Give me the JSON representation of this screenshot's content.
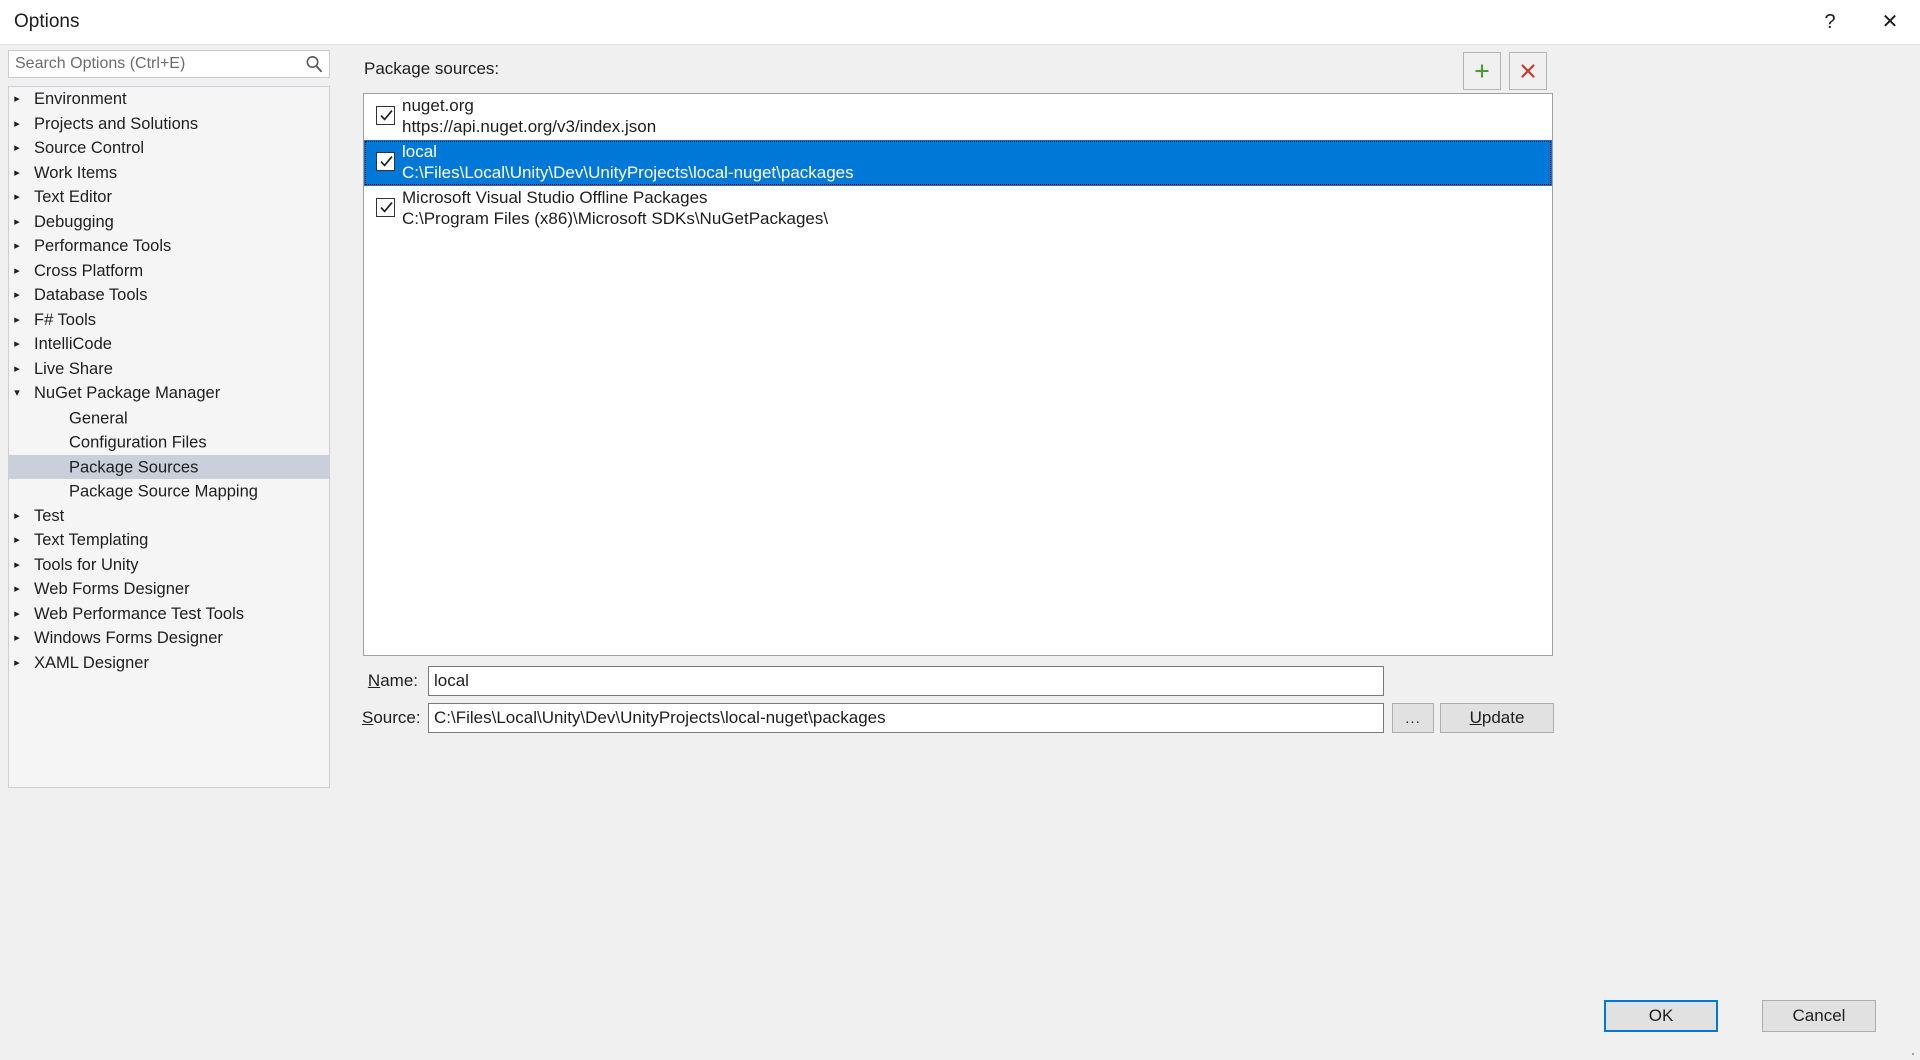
{
  "window": {
    "title": "Options",
    "help_glyph": "?",
    "close_glyph": "✕"
  },
  "search": {
    "placeholder": "Search Options (Ctrl+E)",
    "value": ""
  },
  "tree": {
    "items": [
      {
        "label": "Environment",
        "level": 0,
        "arrow": "▸",
        "selected": false
      },
      {
        "label": "Projects and Solutions",
        "level": 0,
        "arrow": "▸",
        "selected": false
      },
      {
        "label": "Source Control",
        "level": 0,
        "arrow": "▸",
        "selected": false
      },
      {
        "label": "Work Items",
        "level": 0,
        "arrow": "▸",
        "selected": false
      },
      {
        "label": "Text Editor",
        "level": 0,
        "arrow": "▸",
        "selected": false
      },
      {
        "label": "Debugging",
        "level": 0,
        "arrow": "▸",
        "selected": false
      },
      {
        "label": "Performance Tools",
        "level": 0,
        "arrow": "▸",
        "selected": false
      },
      {
        "label": "Cross Platform",
        "level": 0,
        "arrow": "▸",
        "selected": false
      },
      {
        "label": "Database Tools",
        "level": 0,
        "arrow": "▸",
        "selected": false
      },
      {
        "label": "F# Tools",
        "level": 0,
        "arrow": "▸",
        "selected": false
      },
      {
        "label": "IntelliCode",
        "level": 0,
        "arrow": "▸",
        "selected": false
      },
      {
        "label": "Live Share",
        "level": 0,
        "arrow": "▸",
        "selected": false
      },
      {
        "label": "NuGet Package Manager",
        "level": 0,
        "arrow": "▾",
        "selected": false
      },
      {
        "label": "General",
        "level": 1,
        "arrow": "",
        "selected": false
      },
      {
        "label": "Configuration Files",
        "level": 1,
        "arrow": "",
        "selected": false
      },
      {
        "label": "Package Sources",
        "level": 1,
        "arrow": "",
        "selected": true
      },
      {
        "label": "Package Source Mapping",
        "level": 1,
        "arrow": "",
        "selected": false
      },
      {
        "label": "Test",
        "level": 0,
        "arrow": "▸",
        "selected": false
      },
      {
        "label": "Text Templating",
        "level": 0,
        "arrow": "▸",
        "selected": false
      },
      {
        "label": "Tools for Unity",
        "level": 0,
        "arrow": "▸",
        "selected": false
      },
      {
        "label": "Web Forms Designer",
        "level": 0,
        "arrow": "▸",
        "selected": false
      },
      {
        "label": "Web Performance Test Tools",
        "level": 0,
        "arrow": "▸",
        "selected": false
      },
      {
        "label": "Windows Forms Designer",
        "level": 0,
        "arrow": "▸",
        "selected": false
      },
      {
        "label": "XAML Designer",
        "level": 0,
        "arrow": "▸",
        "selected": false
      }
    ]
  },
  "main": {
    "package_sources_label": "Package sources:",
    "add_button_glyph": "+",
    "remove_button_glyph": "✕",
    "sources": [
      {
        "name": "nuget.org",
        "url": "https://api.nuget.org/v3/index.json",
        "checked": true,
        "selected": false
      },
      {
        "name": "local",
        "url": "C:\\Files\\Local\\Unity\\Dev\\UnityProjects\\local-nuget\\packages",
        "checked": true,
        "selected": true
      },
      {
        "name": "Microsoft Visual Studio Offline Packages",
        "url": "C:\\Program Files (x86)\\Microsoft SDKs\\NuGetPackages\\",
        "checked": true,
        "selected": false
      }
    ]
  },
  "form": {
    "name_label_prefix": "",
    "name_label_accel": "N",
    "name_label_suffix": "ame:",
    "name_value": "local",
    "source_label_accel": "S",
    "source_label_suffix": "ource:",
    "source_value": "C:\\Files\\Local\\Unity\\Dev\\UnityProjects\\local-nuget\\packages",
    "browse_label": "...",
    "update_label_accel": "U",
    "update_label_suffix": "pdate"
  },
  "footer": {
    "ok_label": "OK",
    "cancel_label": "Cancel"
  },
  "colors": {
    "selection_blue": "#0078d7",
    "tree_selection": "#c9cfdb",
    "add_green": "#4d9b2f",
    "remove_red": "#c0392b",
    "dialog_bg": "#f0f0f0"
  }
}
